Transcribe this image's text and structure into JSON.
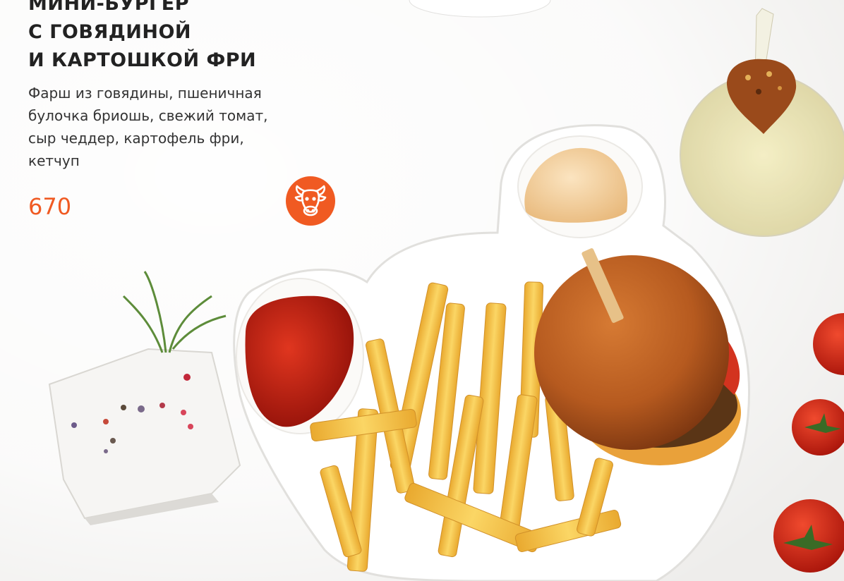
{
  "product": {
    "title_lines": [
      "Мини-бургер",
      "с говядиной",
      "и картошкой фри"
    ],
    "description_lines": [
      "Фарш из говядины, пшеничная",
      "булочка бриошь, свежий томат,",
      "сыр чеддер, картофель фри,",
      "кетчуп"
    ],
    "price": "670",
    "badge_icon": "beef-icon"
  },
  "colors": {
    "accent": "#f05a22",
    "text_dark": "#222222",
    "background": "#f1f0ee"
  }
}
